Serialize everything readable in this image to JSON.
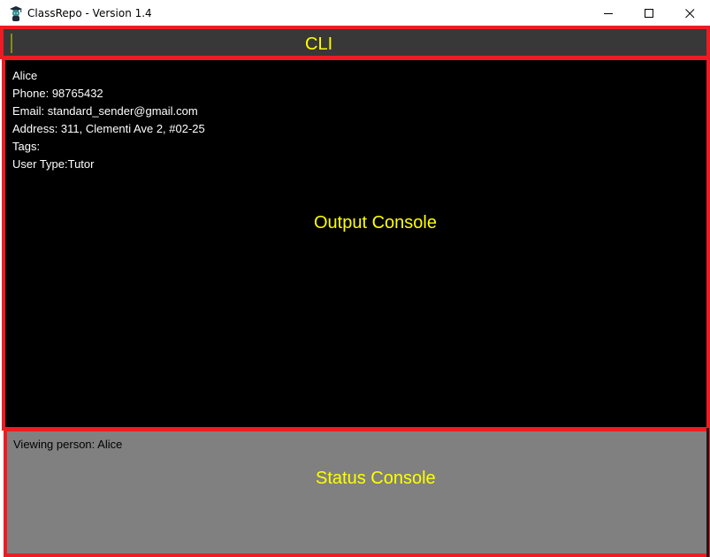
{
  "window": {
    "title": "ClassRepo - Version 1.4",
    "app_icon": "student-mascot-icon",
    "controls": {
      "minimize_icon": "minimize-icon",
      "maximize_icon": "maximize-icon",
      "close_icon": "close-icon"
    }
  },
  "cli": {
    "label": "CLI",
    "value": "",
    "placeholder": ""
  },
  "output": {
    "label": "Output Console",
    "lines": [
      "Alice",
      "Phone: 98765432",
      "Email: standard_sender@gmail.com",
      "Address: 311, Clementi Ave 2, #02-25",
      "Tags: ",
      "User Type:Tutor"
    ]
  },
  "status": {
    "label": "Status Console",
    "text": "Viewing person: Alice"
  },
  "colors": {
    "highlight_border": "#ed1c24",
    "annotation_text": "#ffff00",
    "cli_background": "#383838",
    "output_background": "#000000",
    "status_background": "#808080"
  }
}
